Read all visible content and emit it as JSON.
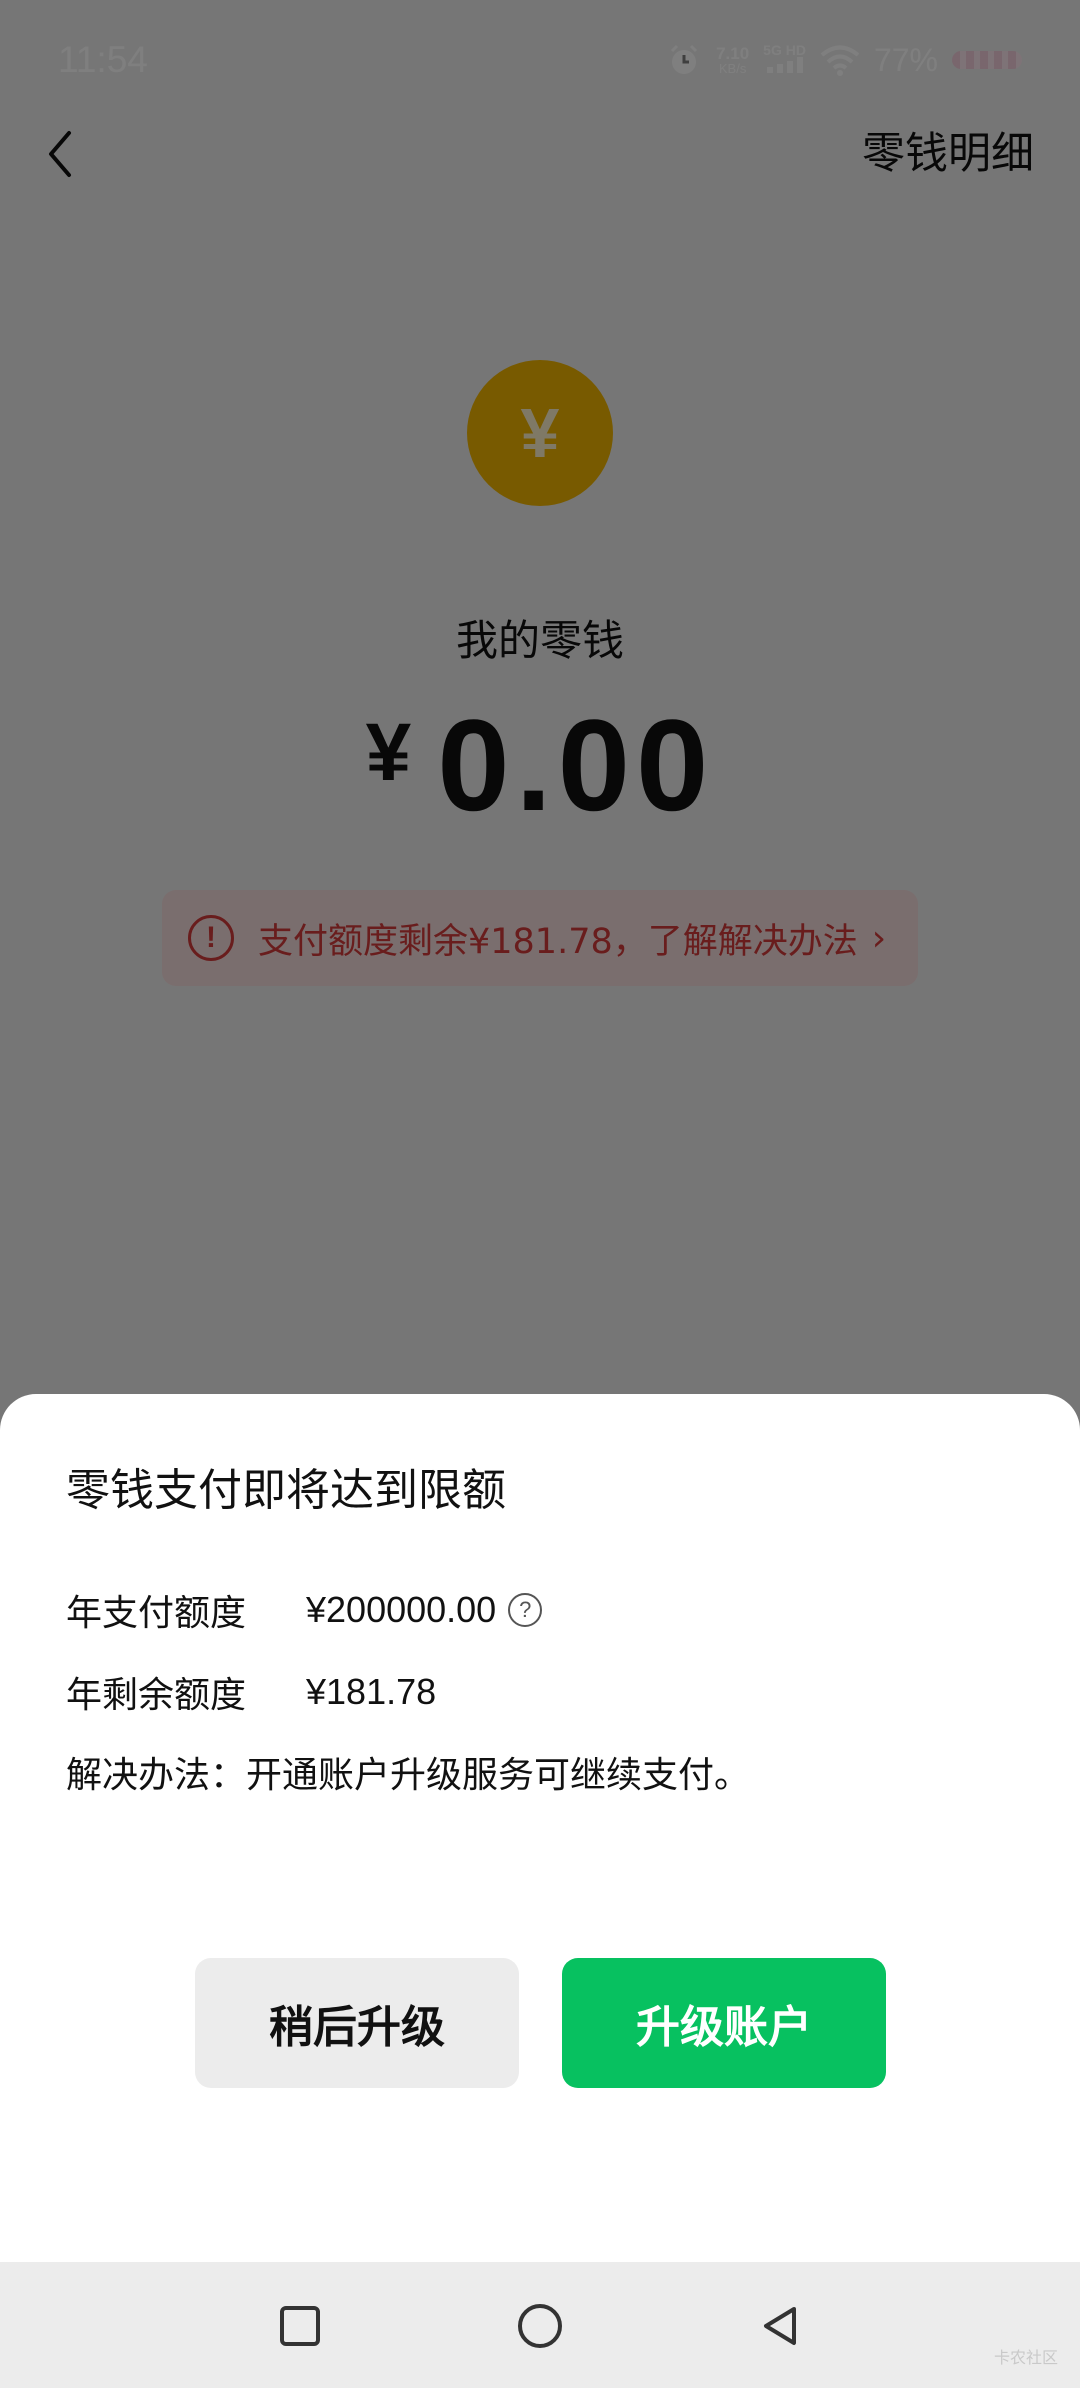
{
  "status_bar": {
    "time": "11:54",
    "net_speed_value": "7.10",
    "net_speed_unit": "KB/s",
    "signal_label": "5G HD",
    "battery": "77%"
  },
  "nav": {
    "right_link": "零钱明细"
  },
  "balance": {
    "coin_symbol": "¥",
    "title": "我的零钱",
    "currency": "¥",
    "amount": "0.00"
  },
  "banner": {
    "icon": "!",
    "text": "支付额度剩余¥181.78，了解解决办法",
    "chevron": "›",
    "color": "#d23b3b"
  },
  "sheet": {
    "title": "零钱支付即将达到限额",
    "annual_limit_label": "年支付额度",
    "annual_limit_value": "¥200000.00",
    "help_icon": "?",
    "remaining_label": "年剩余额度",
    "remaining_value": "¥181.78",
    "solution_text": "解决办法：开通账户升级服务可继续支付。",
    "later_button": "稍后升级",
    "upgrade_button": "升级账户",
    "upgrade_color": "#07c160"
  },
  "watermark": "卡农社区"
}
